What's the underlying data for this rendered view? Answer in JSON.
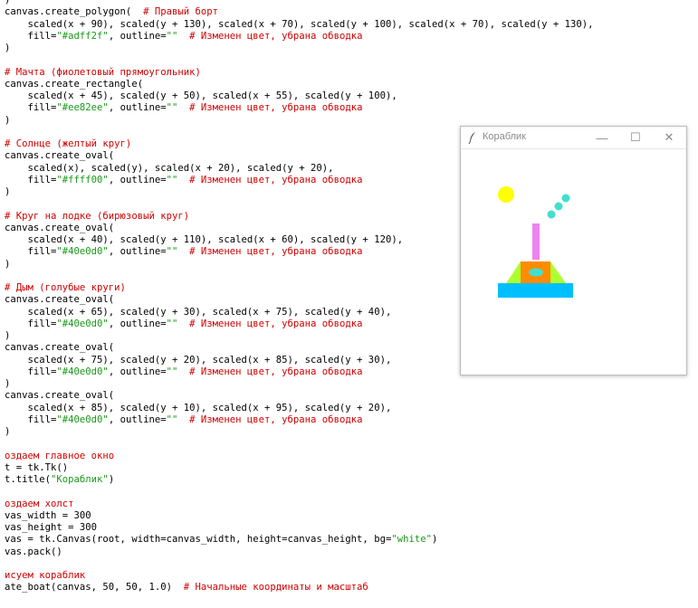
{
  "code": {
    "lines": [
      [
        {
          "t": ")",
          "k": "p"
        }
      ],
      [
        {
          "t": "canvas.create_polygon(  ",
          "k": "p"
        },
        {
          "t": "# Правый борт",
          "k": "c"
        }
      ],
      [
        {
          "t": "    scaled(x + 90), scaled(y + 130), scaled(x + 70), scaled(y + 100), scaled(x + 70), scaled(y + 130),",
          "k": "p"
        }
      ],
      [
        {
          "t": "    fill=",
          "k": "p"
        },
        {
          "t": "\"#adff2f\"",
          "k": "s"
        },
        {
          "t": ", outline=",
          "k": "p"
        },
        {
          "t": "\"\"",
          "k": "s"
        },
        {
          "t": "  # Изменен цвет, убрана обводка",
          "k": "c"
        }
      ],
      [
        {
          "t": ")",
          "k": "p"
        }
      ],
      [],
      [
        {
          "t": "# Мачта (фиолетовый прямоугольник)",
          "k": "c"
        }
      ],
      [
        {
          "t": "canvas.create_rectangle(",
          "k": "p"
        }
      ],
      [
        {
          "t": "    scaled(x + 45), scaled(y + 50), scaled(x + 55), scaled(y + 100),",
          "k": "p"
        }
      ],
      [
        {
          "t": "    fill=",
          "k": "p"
        },
        {
          "t": "\"#ee82ee\"",
          "k": "s"
        },
        {
          "t": ", outline=",
          "k": "p"
        },
        {
          "t": "\"\"",
          "k": "s"
        },
        {
          "t": "  # Изменен цвет, убрана обводка",
          "k": "c"
        }
      ],
      [
        {
          "t": ")",
          "k": "p"
        }
      ],
      [],
      [
        {
          "t": "# Солнце (желтый круг)",
          "k": "c"
        }
      ],
      [
        {
          "t": "canvas.create_oval(",
          "k": "p"
        }
      ],
      [
        {
          "t": "    scaled(x), scaled(y), scaled(x + 20), scaled(y + 20),",
          "k": "p"
        }
      ],
      [
        {
          "t": "    fill=",
          "k": "p"
        },
        {
          "t": "\"#ffff00\"",
          "k": "s"
        },
        {
          "t": ", outline=",
          "k": "p"
        },
        {
          "t": "\"\"",
          "k": "s"
        },
        {
          "t": "  # Изменен цвет, убрана обводка",
          "k": "c"
        }
      ],
      [
        {
          "t": ")",
          "k": "p"
        }
      ],
      [],
      [
        {
          "t": "# Круг на лодке (бирюзовый круг)",
          "k": "c"
        }
      ],
      [
        {
          "t": "canvas.create_oval(",
          "k": "p"
        }
      ],
      [
        {
          "t": "    scaled(x + 40), scaled(y + 110), scaled(x + 60), scaled(y + 120),",
          "k": "p"
        }
      ],
      [
        {
          "t": "    fill=",
          "k": "p"
        },
        {
          "t": "\"#40e0d0\"",
          "k": "s"
        },
        {
          "t": ", outline=",
          "k": "p"
        },
        {
          "t": "\"\"",
          "k": "s"
        },
        {
          "t": "  # Изменен цвет, убрана обводка",
          "k": "c"
        }
      ],
      [
        {
          "t": ")",
          "k": "p"
        }
      ],
      [],
      [
        {
          "t": "# Дым (голубые круги)",
          "k": "c"
        }
      ],
      [
        {
          "t": "canvas.create_oval(",
          "k": "p"
        }
      ],
      [
        {
          "t": "    scaled(x + 65), scaled(y + 30), scaled(x + 75), scaled(y + 40),",
          "k": "p"
        }
      ],
      [
        {
          "t": "    fill=",
          "k": "p"
        },
        {
          "t": "\"#40e0d0\"",
          "k": "s"
        },
        {
          "t": ", outline=",
          "k": "p"
        },
        {
          "t": "\"\"",
          "k": "s"
        },
        {
          "t": "  # Изменен цвет, убрана обводка",
          "k": "c"
        }
      ],
      [
        {
          "t": ")",
          "k": "p"
        }
      ],
      [
        {
          "t": "canvas.create_oval(",
          "k": "p"
        }
      ],
      [
        {
          "t": "    scaled(x + 75), scaled(y + 20), scaled(x + 85), scaled(y + 30),",
          "k": "p"
        }
      ],
      [
        {
          "t": "    fill=",
          "k": "p"
        },
        {
          "t": "\"#40e0d0\"",
          "k": "s"
        },
        {
          "t": ", outline=",
          "k": "p"
        },
        {
          "t": "\"\"",
          "k": "s"
        },
        {
          "t": "  # Изменен цвет, убрана обводка",
          "k": "c"
        }
      ],
      [
        {
          "t": ")",
          "k": "p"
        }
      ],
      [
        {
          "t": "canvas.create_oval(",
          "k": "p"
        }
      ],
      [
        {
          "t": "    scaled(x + 85), scaled(y + 10), scaled(x + 95), scaled(y + 20),",
          "k": "p"
        }
      ],
      [
        {
          "t": "    fill=",
          "k": "p"
        },
        {
          "t": "\"#40e0d0\"",
          "k": "s"
        },
        {
          "t": ", outline=",
          "k": "p"
        },
        {
          "t": "\"\"",
          "k": "s"
        },
        {
          "t": "  # Изменен цвет, убрана обводка",
          "k": "c"
        }
      ],
      [
        {
          "t": ")",
          "k": "p"
        }
      ],
      [],
      [
        {
          "t": "оздаем главное окно",
          "k": "c"
        }
      ],
      [
        {
          "t": "t = tk.Tk()",
          "k": "p"
        }
      ],
      [
        {
          "t": "t.title(",
          "k": "p"
        },
        {
          "t": "\"Кораблик\"",
          "k": "s"
        },
        {
          "t": ")",
          "k": "p"
        }
      ],
      [],
      [
        {
          "t": "оздаем холст",
          "k": "c"
        }
      ],
      [
        {
          "t": "vas_width = 300",
          "k": "p"
        }
      ],
      [
        {
          "t": "vas_height = 300",
          "k": "p"
        }
      ],
      [
        {
          "t": "vas = tk.Canvas(root, width=canvas_width, height=canvas_height, bg=",
          "k": "p"
        },
        {
          "t": "\"white\"",
          "k": "s"
        },
        {
          "t": ")",
          "k": "p"
        }
      ],
      [
        {
          "t": "vas.pack()",
          "k": "p"
        }
      ],
      [],
      [
        {
          "t": "исуем кораблик",
          "k": "c"
        }
      ],
      [
        {
          "t": "ate_boat(canvas, 50, 50, 1.0)  ",
          "k": "p"
        },
        {
          "t": "# Начальные координаты и масштаб",
          "k": "c"
        }
      ]
    ]
  },
  "tk_window": {
    "title": "Кораблик",
    "min_glyph": "—",
    "max_glyph": "☐",
    "close_glyph": "✕",
    "feather_icon": "tk-feather-icon"
  },
  "colors": {
    "comment": "#d00000",
    "string": "#1a9a1a",
    "sun": "#ffff00",
    "mast": "#ee82ee",
    "hull_side": "#adff2f",
    "hull_center": "#ff8c00",
    "porthole": "#40e0d0",
    "smoke": "#40e0d0",
    "base": "#00bfff"
  }
}
